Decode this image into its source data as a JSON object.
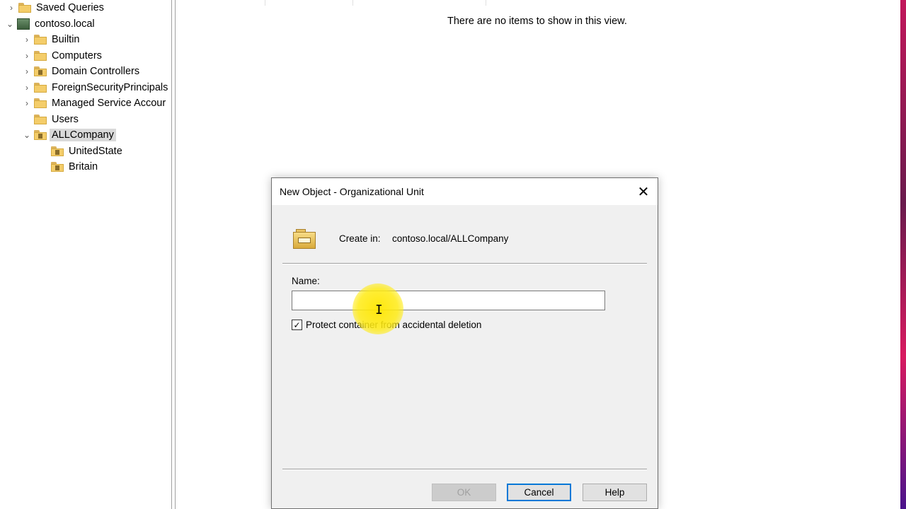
{
  "tree": {
    "items": [
      {
        "label": "Saved Queries",
        "expander": "›"
      },
      {
        "label": "contoso.local",
        "expander": "⌄"
      },
      {
        "label": "Builtin",
        "expander": "›"
      },
      {
        "label": "Computers",
        "expander": "›"
      },
      {
        "label": "Domain Controllers",
        "expander": "›"
      },
      {
        "label": "ForeignSecurityPrincipals",
        "expander": "›"
      },
      {
        "label": "Managed Service Accour",
        "expander": "›"
      },
      {
        "label": "Users",
        "expander": ""
      },
      {
        "label": "ALLCompany",
        "expander": "⌄"
      },
      {
        "label": "UnitedState",
        "expander": ""
      },
      {
        "label": "Britain",
        "expander": ""
      }
    ],
    "selected": "ALLCompany"
  },
  "content": {
    "empty_message": "There are no items to show in this view."
  },
  "dialog": {
    "title": "New Object - Organizational Unit",
    "close_glyph": "✕",
    "create_in_label": "Create in:",
    "create_in_value": "contoso.local/ALLCompany",
    "name_label": "Name:",
    "name_value": "",
    "protect_label": "Protect container from accidental deletion",
    "protect_checked": true,
    "check_glyph": "✓",
    "buttons": {
      "ok": "OK",
      "cancel": "Cancel",
      "help": "Help"
    }
  },
  "cursor": {
    "glyph": "I"
  },
  "colors": {
    "accent": "#0078d7",
    "selection": "#d9d9d9",
    "dialog_bg": "#f0f0f0"
  }
}
